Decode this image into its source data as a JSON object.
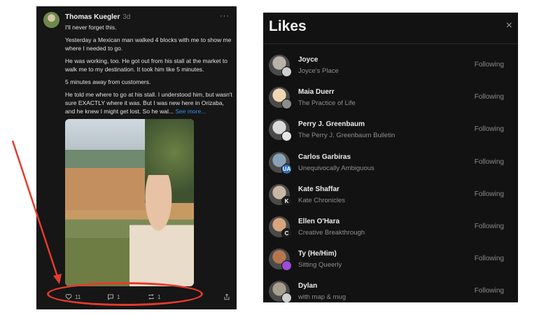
{
  "post": {
    "author": "Thomas Kuegler",
    "age": "3d",
    "more": "···",
    "paragraphs": [
      "I'll never forget this.",
      "Yesterday a Mexican man walked 4 blocks with me to show me where I needed to go.",
      "He was working, too. He got out from his stall at the market to walk me to my destination. It took him like 5 minutes.",
      "5 minutes away from customers.",
      "He told me where to go at his stall. I understood him, but wasn't sure EXACTLY where it was. But I was new here in Orizaba, and he knew I might get lost. So he wal..."
    ],
    "see_more": "See more...",
    "actions": {
      "likes": "11",
      "comments": "1",
      "restacks": "1"
    }
  },
  "likes": {
    "title": "Likes",
    "close": "×",
    "follow_label": "Following",
    "items": [
      {
        "name": "Joyce",
        "sub": "Joyce's Place",
        "badge": "",
        "badge_color": "#cfcfcf",
        "avatar_color": "#b8b2a8"
      },
      {
        "name": "Maia Duerr",
        "sub": "The Practice of Life",
        "badge": "",
        "badge_color": "#8d8d8d",
        "avatar_color": "#f0d7b4"
      },
      {
        "name": "Perry J. Greenbaum",
        "sub": "The Perry J. Greenbaum Bulletin",
        "badge": "",
        "badge_color": "#e6e6e6",
        "avatar_color": "#d9d9d9"
      },
      {
        "name": "Carlos Garbiras",
        "sub": "Unequivocally Ambiguous",
        "badge": "UA",
        "badge_color": "#2f6fb7",
        "avatar_color": "#8aa2b8"
      },
      {
        "name": "Kate Shaffar",
        "sub": "Kate Chronicles",
        "badge": "K",
        "badge_color": "#1b1b1b",
        "avatar_color": "#c9b6a5"
      },
      {
        "name": "Ellen O'Hara",
        "sub": "Creative Breakthrough",
        "badge": "C",
        "badge_color": "#1b1b1b",
        "avatar_color": "#d8a47d"
      },
      {
        "name": "Ty (He/Him)",
        "sub": "Sitting Queerly",
        "badge": "",
        "badge_color": "#9b4dd6",
        "avatar_color": "#b5764f"
      },
      {
        "name": "Dylan",
        "sub": "with map & mug",
        "badge": "",
        "badge_color": "#cfcfcf",
        "avatar_color": "#a79f8e"
      }
    ]
  }
}
